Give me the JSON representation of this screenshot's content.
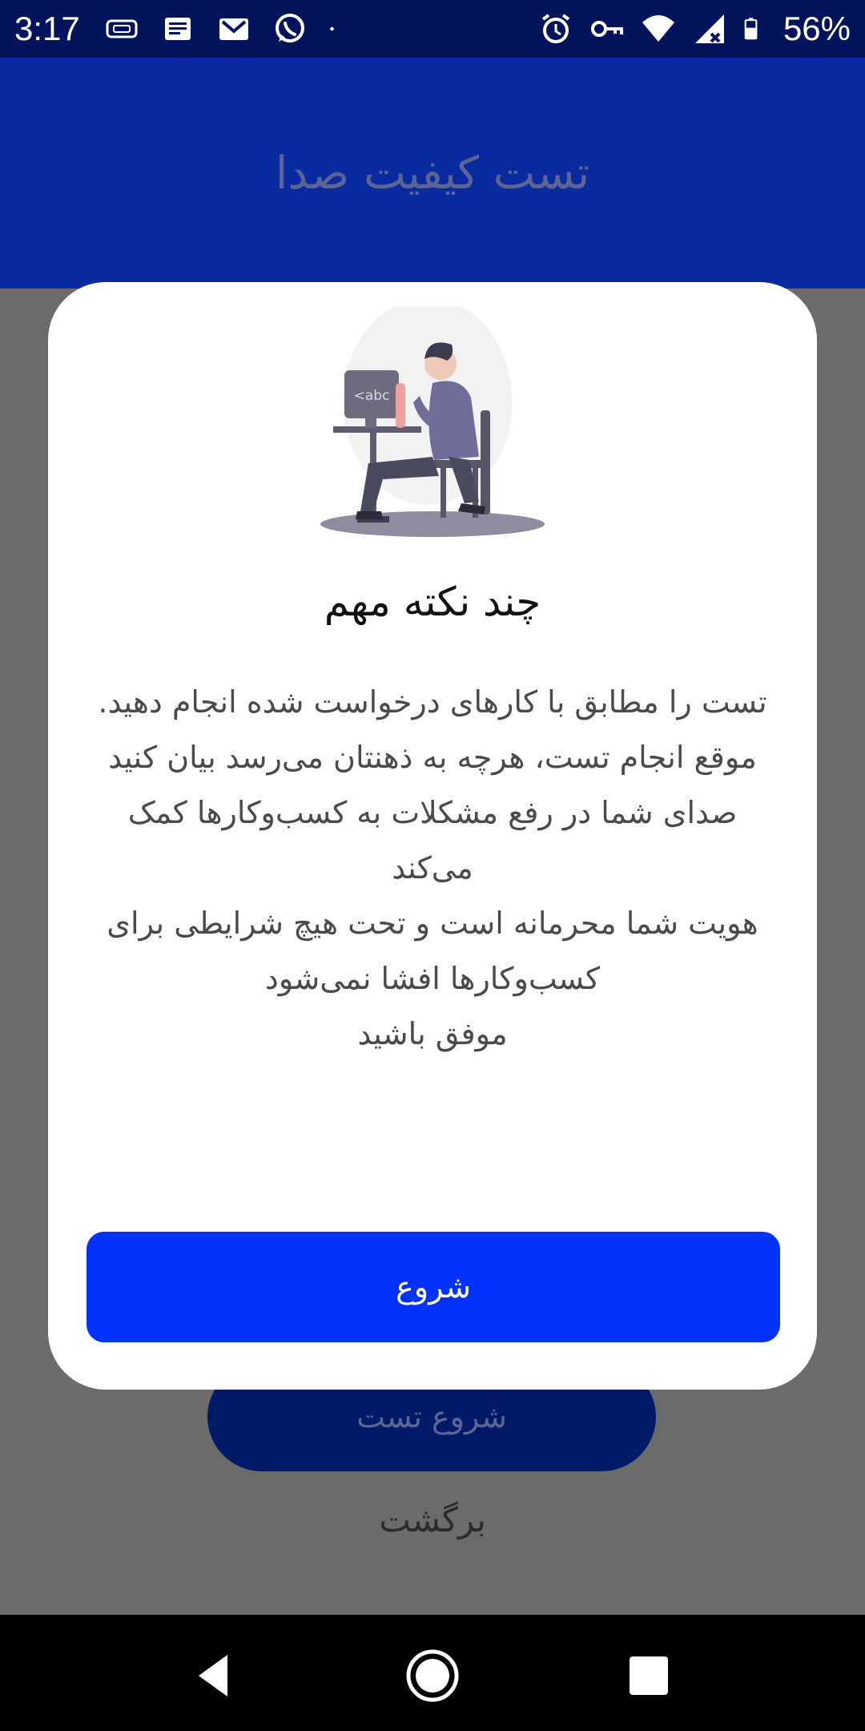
{
  "status_bar": {
    "time": "3:17",
    "battery": "56%",
    "left_icons": [
      "sim-card-icon",
      "message-icon",
      "gmail-icon",
      "whatsapp-icon",
      "dot-icon"
    ],
    "right_icons": [
      "alarm-icon",
      "vpn-key-icon",
      "wifi-icon",
      "signal-icon",
      "battery-icon"
    ]
  },
  "header": {
    "title": "تست کیفیت صدا",
    "color": "#0a2aa0"
  },
  "background": {
    "start_test_label": "شروع تست",
    "back_label": "برگشت"
  },
  "dialog": {
    "illustration": "person-at-computer-illustration",
    "title": "چند نکته مهم",
    "body_lines": [
      "تست را مطابق با کارهای درخواست شده انجام دهید.",
      "موقع انجام تست، هرچه به ذهنتان می‌رسد بیان کنید",
      "صدای شما در رفع مشکلات به کسب‌وکارها کمک می‌کند",
      "هویت شما محرمانه است و تحت هیچ شرایطی برای کسب‌وکارها افشا نمی‌شود",
      "موفق باشید"
    ],
    "start_label": "شروع",
    "button_color": "#0332fd"
  },
  "nav_bar": {
    "icons": [
      "back-icon",
      "home-icon",
      "recents-icon"
    ]
  }
}
